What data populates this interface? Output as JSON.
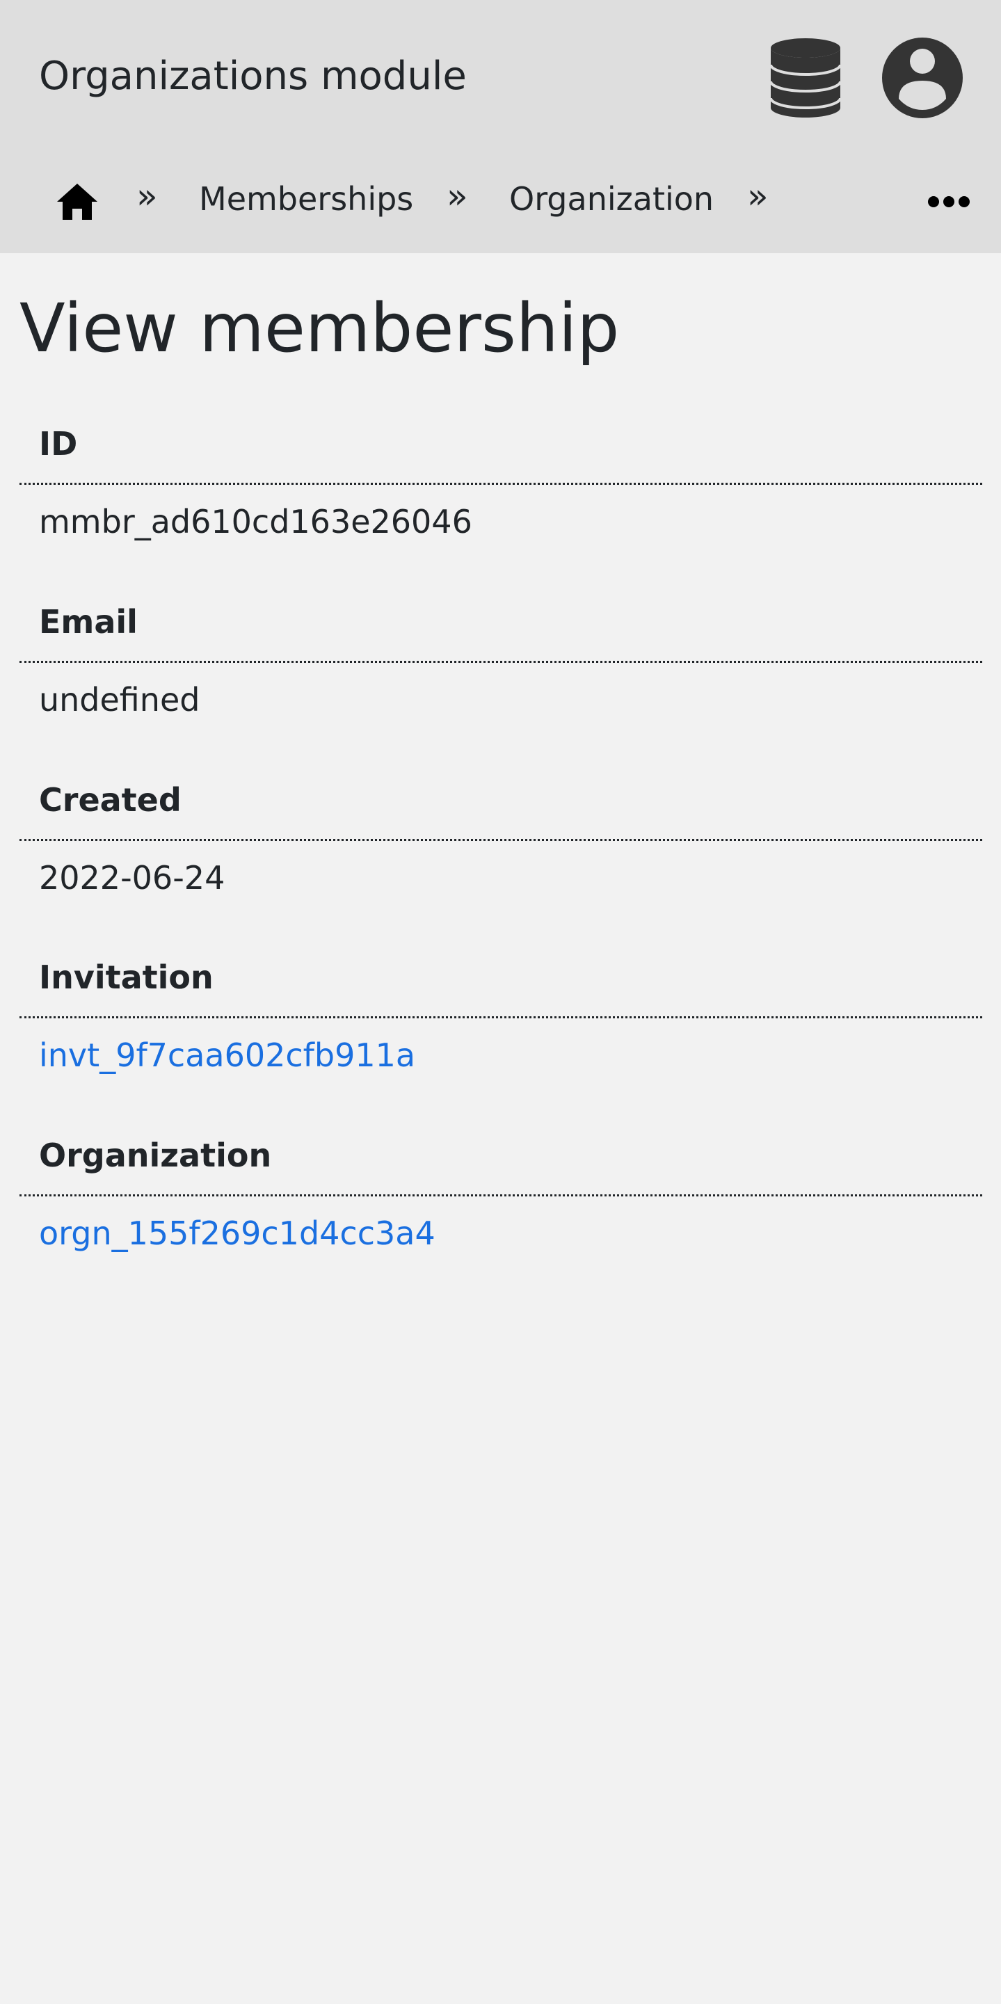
{
  "header": {
    "app_title": "Organizations module",
    "icons": [
      "database-icon",
      "user-account-icon"
    ]
  },
  "breadcrumb": {
    "home_icon": "home-icon",
    "separator": "»",
    "items": [
      {
        "label": "Memberships"
      },
      {
        "label": "Organization"
      }
    ],
    "more_icon": "ellipsis-icon"
  },
  "page": {
    "title": "View membership"
  },
  "fields": [
    {
      "label": "ID",
      "value": "mmbr_ad610cd163e26046",
      "is_link": false
    },
    {
      "label": "Email",
      "value": "undefined",
      "is_link": false
    },
    {
      "label": "Created",
      "value": "2022-06-24",
      "is_link": false
    },
    {
      "label": "Invitation",
      "value": "invt_9f7caa602cfb911a",
      "is_link": true
    },
    {
      "label": "Organization",
      "value": "orgn_155f269c1d4cc3a4",
      "is_link": true
    }
  ],
  "colors": {
    "header_bg": "#dedede",
    "page_bg": "#f2f2f2",
    "text": "#212529",
    "link": "#1a6fe0",
    "icon": "#343434"
  }
}
